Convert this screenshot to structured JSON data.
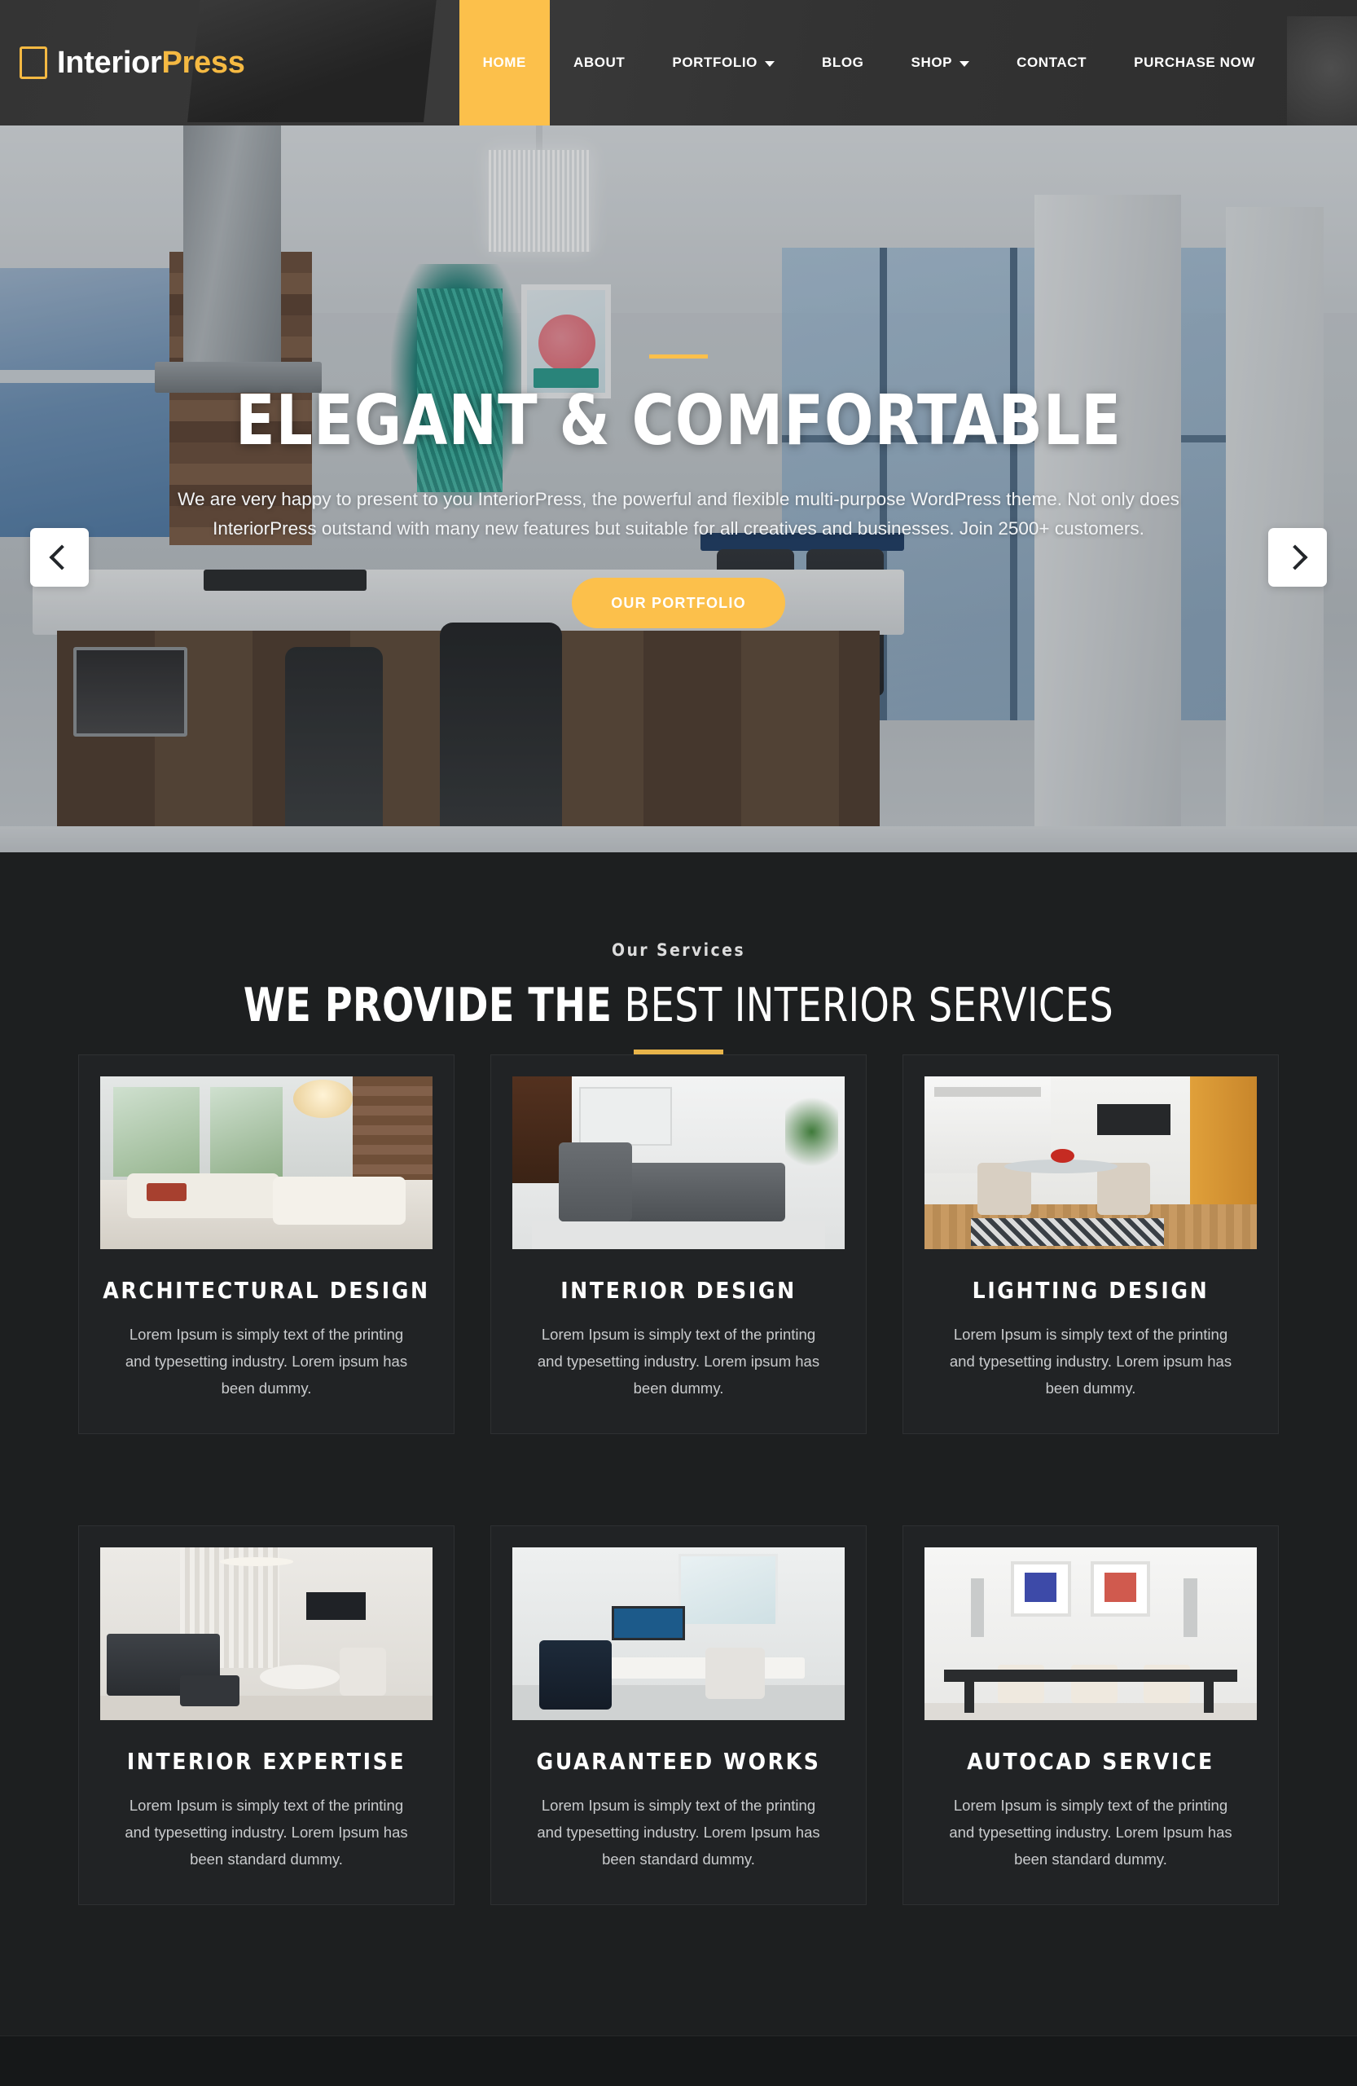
{
  "header": {
    "logo": {
      "mark": "square-outline-icon",
      "text_primary": "Interior",
      "text_accent": "Press"
    },
    "nav": [
      {
        "label": "HOME",
        "active": true,
        "dropdown": false
      },
      {
        "label": "ABOUT",
        "active": false,
        "dropdown": false
      },
      {
        "label": "PORTFOLIO",
        "active": false,
        "dropdown": true
      },
      {
        "label": "BLOG",
        "active": false,
        "dropdown": false
      },
      {
        "label": "SHOP",
        "active": false,
        "dropdown": true
      },
      {
        "label": "CONTACT",
        "active": false,
        "dropdown": false
      },
      {
        "label": "PURCHASE NOW",
        "active": false,
        "dropdown": false
      }
    ]
  },
  "hero": {
    "title": "ELEGANT & COMFORTABLE",
    "description": "We are very happy to present to you InteriorPress, the powerful and flexible multi-purpose WordPress theme. Not only does InteriorPress outstand with many new features but suitable for all creatives and businesses. Join 2500+ customers.",
    "cta_label": "OUR PORTFOLIO",
    "prev_icon": "chevron-left-icon",
    "next_icon": "chevron-right-icon"
  },
  "services": {
    "eyebrow": "Our Services",
    "title_bold": "WE PROVIDE THE",
    "title_light": "BEST INTERIOR SERVICES",
    "cards": [
      {
        "title": "ARCHITECTURAL DESIGN",
        "desc": "Lorem Ipsum is simply text of the printing and typesetting industry. Lorem ipsum has been dummy."
      },
      {
        "title": "INTERIOR DESIGN",
        "desc": "Lorem Ipsum is simply text of the printing and typesetting industry. Lorem ipsum has been dummy."
      },
      {
        "title": "LIGHTING DESIGN",
        "desc": "Lorem Ipsum is simply text of the printing and typesetting industry. Lorem ipsum has been dummy."
      },
      {
        "title": "INTERIOR EXPERTISE",
        "desc": "Lorem Ipsum is simply text of the printing and typesetting industry. Lorem Ipsum has been standard dummy."
      },
      {
        "title": "GUARANTEED WORKS",
        "desc": "Lorem Ipsum is simply text of the printing and typesetting industry. Lorem Ipsum has been standard dummy."
      },
      {
        "title": "AUTOCAD SERVICE",
        "desc": "Lorem Ipsum is simply text of the printing and typesetting industry. Lorem Ipsum has been standard dummy."
      }
    ]
  },
  "colors": {
    "accent": "#fcc04b",
    "accent_underline": "#e8b44a",
    "header_bg": "#363636",
    "section_bg": "#1d1f20",
    "card_bg": "#212325"
  }
}
